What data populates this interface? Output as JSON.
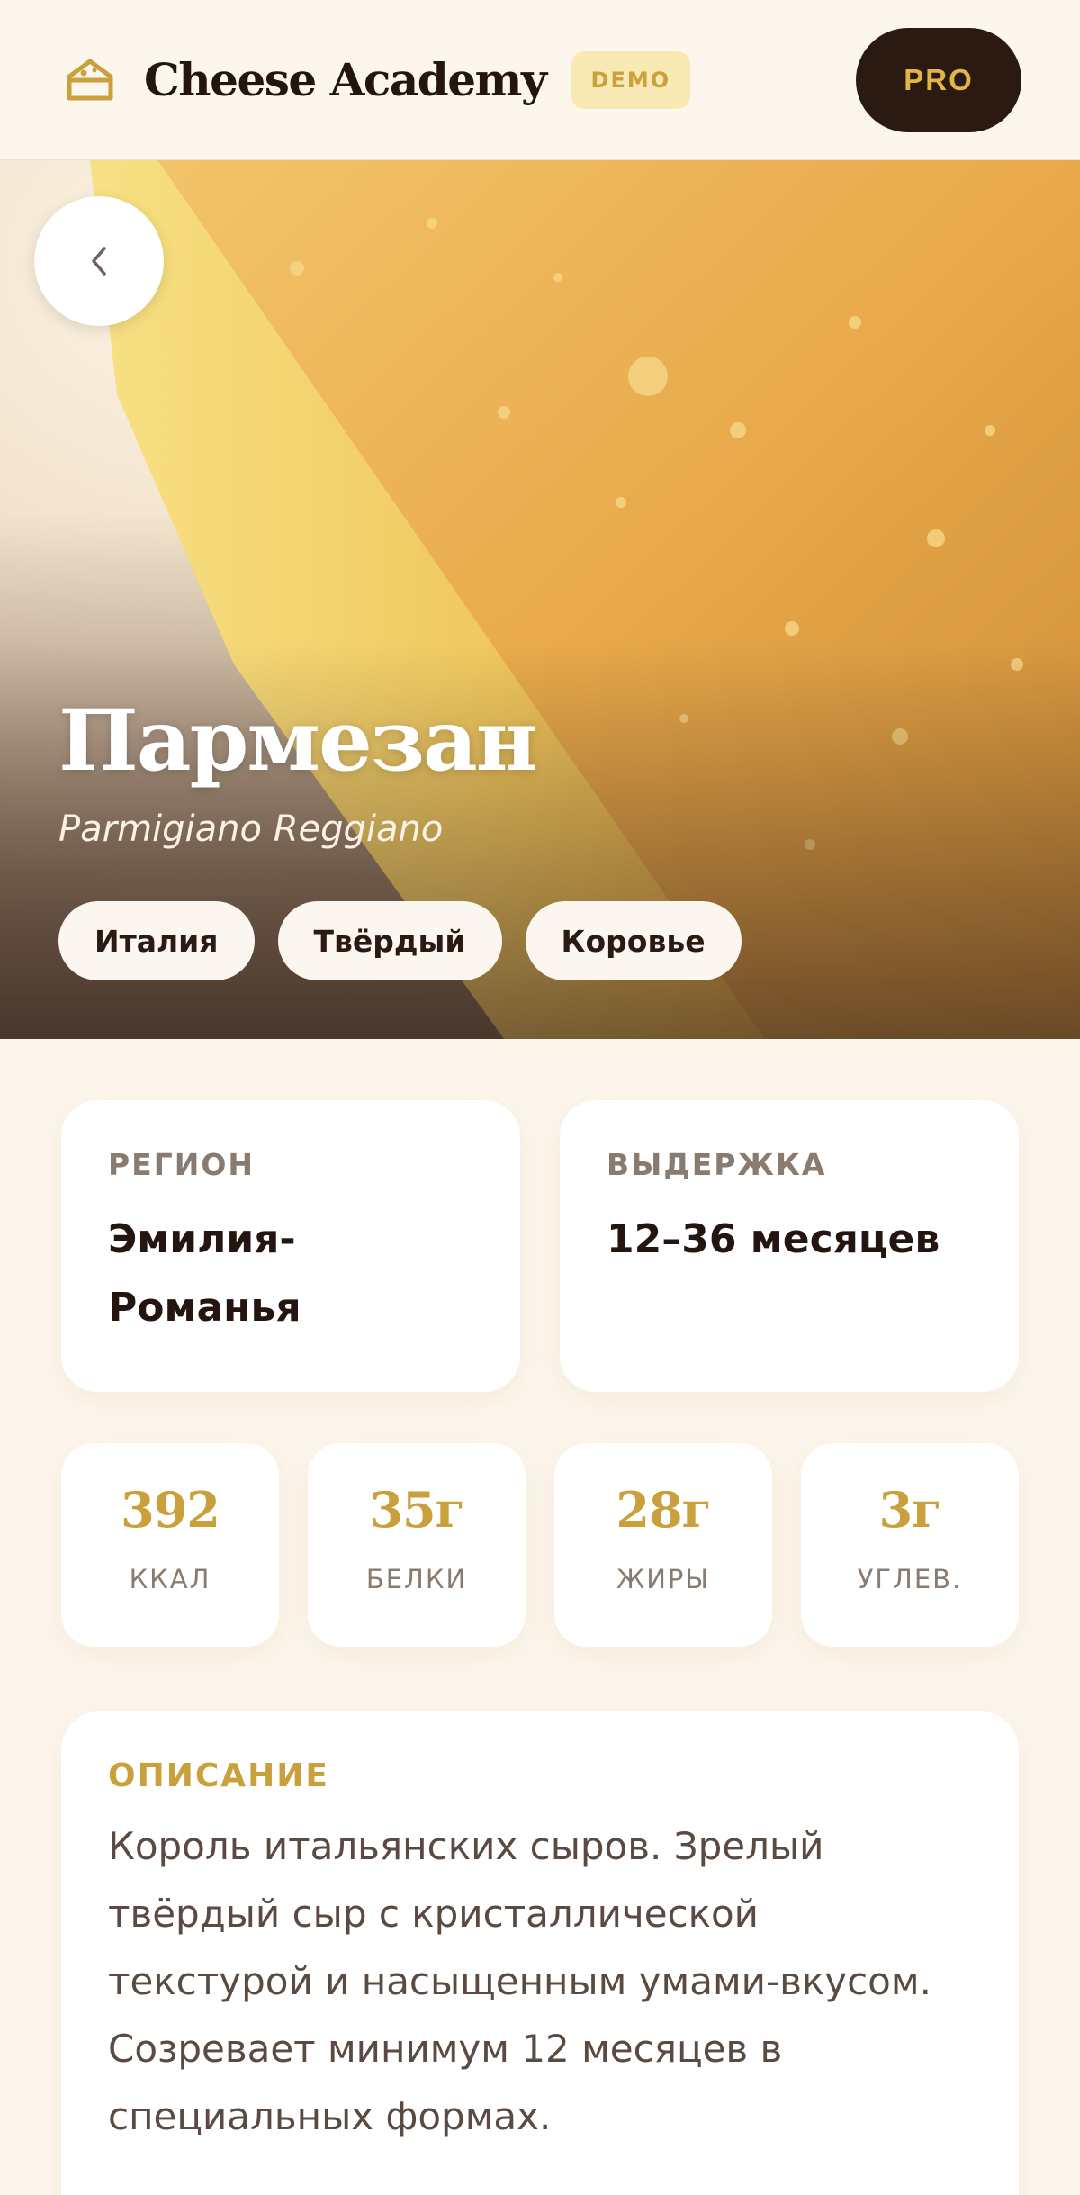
{
  "header": {
    "app_title": "Cheese Academy",
    "demo_badge": "DEMO",
    "pro_label": "PRO",
    "logo_icon": "cheese-house-icon"
  },
  "hero": {
    "back_icon": "chevron-left-icon",
    "name": "Пармезан",
    "latin_name": "Parmigiano Reggiano",
    "tags": [
      "Италия",
      "Твёрдый",
      "Коровье"
    ]
  },
  "info": {
    "region": {
      "label": "РЕГИОН",
      "value": "Эмилия-Романья"
    },
    "aging": {
      "label": "ВЫДЕРЖКА",
      "value": "12–36 месяцев"
    }
  },
  "nutrition": [
    {
      "value": "392",
      "label": "ККАЛ"
    },
    {
      "value": "35г",
      "label": "БЕЛКИ"
    },
    {
      "value": "28г",
      "label": "ЖИРЫ"
    },
    {
      "value": "3г",
      "label": "УГЛЕВ."
    }
  ],
  "description": {
    "title": "ОПИСАНИЕ",
    "text": "Король итальянских сыров. Зрелый твёрдый сыр с кристаллической текстурой и насыщенным умами-вкусом. Созревает минимум 12 месяцев в специальных формах."
  },
  "colors": {
    "background": "#fdf6ec",
    "accent_gold": "#c9a03c",
    "dark_brown": "#2b1a12",
    "demo_badge_bg": "#f9eab5"
  }
}
